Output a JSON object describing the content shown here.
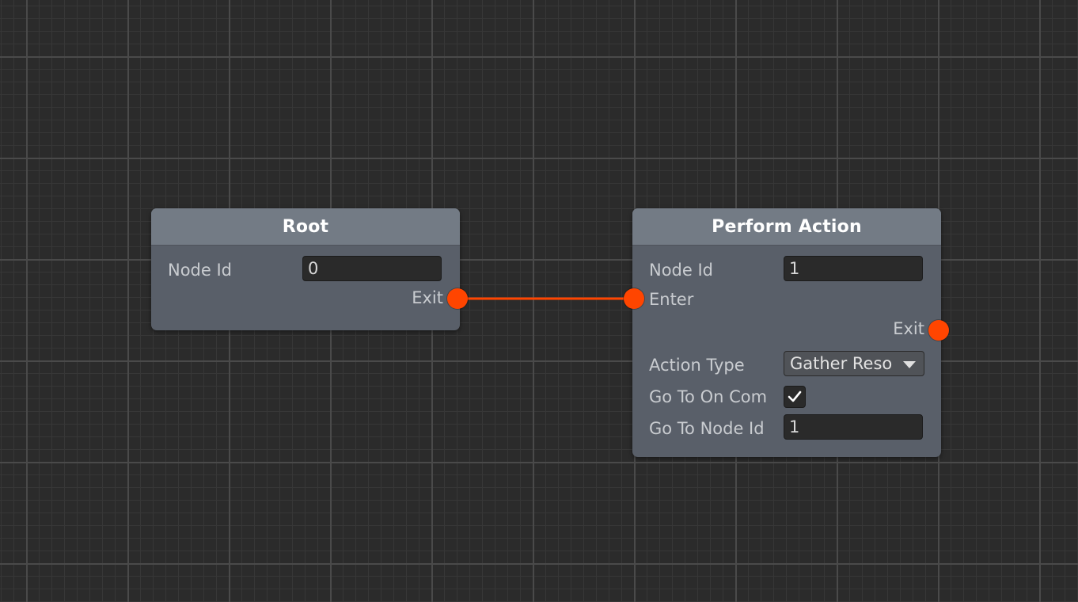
{
  "colors": {
    "background": "#2b2b2b",
    "node_body": "#595f69",
    "node_header": "#737b85",
    "connection": "#ff4500"
  },
  "nodes": {
    "root": {
      "title": "Root",
      "node_id_label": "Node Id",
      "node_id_value": "0",
      "exit_label": "Exit"
    },
    "perform_action": {
      "title": "Perform Action",
      "node_id_label": "Node Id",
      "node_id_value": "1",
      "enter_label": "Enter",
      "exit_label": "Exit",
      "action_type_label": "Action Type",
      "action_type_value": "Gather Reso",
      "go_to_on_complete_label": "Go To On Com",
      "go_to_on_complete_checked": true,
      "go_to_node_id_label": "Go To Node Id",
      "go_to_node_id_value": "1"
    }
  },
  "icons": {
    "dropdown": "chevron-down-icon",
    "checkbox": "checkmark-icon",
    "port": "port-circle-icon"
  }
}
